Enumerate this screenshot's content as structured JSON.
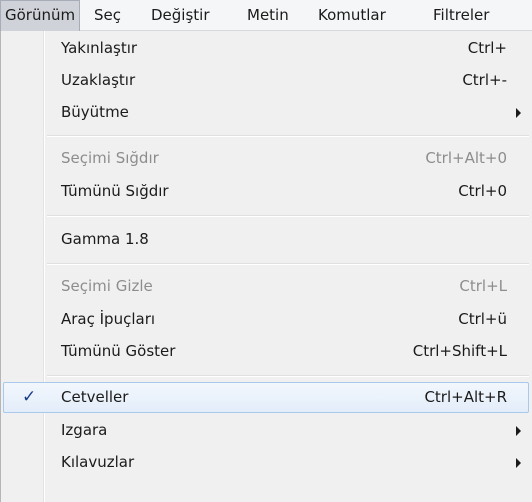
{
  "menubar": {
    "items": [
      {
        "label": "Görünüm"
      },
      {
        "label": "Seç"
      },
      {
        "label": "Değiştir"
      },
      {
        "label": "Metin"
      },
      {
        "label": "Komutlar"
      },
      {
        "label": "Filtreler"
      }
    ]
  },
  "menu": {
    "items": [
      {
        "label": "Yakınlaştır",
        "shortcut": "Ctrl+"
      },
      {
        "label": "Uzaklaştır",
        "shortcut": "Ctrl+-"
      },
      {
        "label": "Büyütme",
        "shortcut": ""
      },
      {
        "label": "Seçimi Sığdır",
        "shortcut": "Ctrl+Alt+0"
      },
      {
        "label": "Tümünü Sığdır",
        "shortcut": "Ctrl+0"
      },
      {
        "label": "Gamma 1.8",
        "shortcut": ""
      },
      {
        "label": "Seçimi Gizle",
        "shortcut": "Ctrl+L"
      },
      {
        "label": "Araç İpuçları",
        "shortcut": "Ctrl+ü"
      },
      {
        "label": "Tümünü Göster",
        "shortcut": "Ctrl+Shift+L"
      },
      {
        "label": "Cetveller",
        "shortcut": "Ctrl+Alt+R",
        "check": "✓"
      },
      {
        "label": "Izgara",
        "shortcut": ""
      },
      {
        "label": "Kılavuzlar",
        "shortcut": ""
      }
    ]
  },
  "colors": {
    "hover_border": "#a8c8ec",
    "disabled_text": "#8d8d8d",
    "checkmark": "#1b3e8a"
  }
}
